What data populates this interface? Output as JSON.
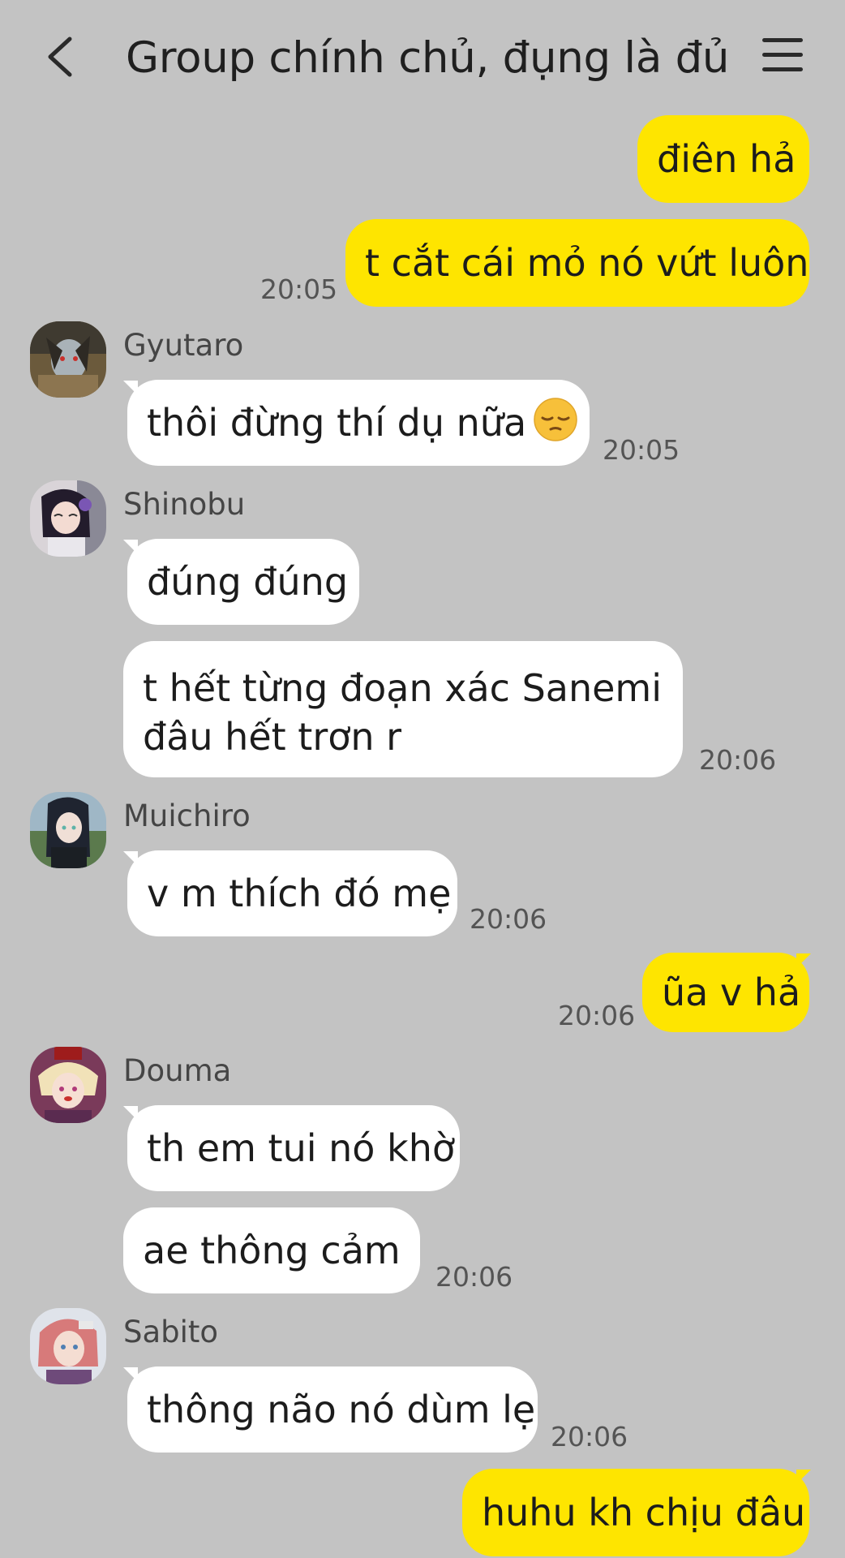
{
  "header": {
    "title": "Group chính chủ, đụng là đủ"
  },
  "messages": {
    "m1": {
      "text": "điên hả"
    },
    "m2": {
      "text": "t cắt cái mỏ nó vứt luôn",
      "time": "20:05"
    },
    "gyutaro": {
      "name": "Gyutaro",
      "text": "thôi đừng thí dụ nữa",
      "emoji": "pensive-face",
      "time": "20:05"
    },
    "shinobu": {
      "name": "Shinobu",
      "text1": "đúng đúng",
      "text2": "t hết từng đoạn xác Sanemi đâu hết trơn r",
      "time": "20:06"
    },
    "muichiro": {
      "name": "Muichiro",
      "text": "v m thích đó mẹ",
      "time": "20:06"
    },
    "m_out2": {
      "text": "ũa v hả",
      "time": "20:06"
    },
    "douma": {
      "name": "Douma",
      "text1": "th em tui nó khờ",
      "text2": "ae thông cảm",
      "time": "20:06"
    },
    "sabito": {
      "name": "Sabito",
      "text": "thông não nó dùm lẹ",
      "time": "20:06"
    },
    "m_out3": {
      "text": "huhu kh chịu đâu"
    }
  },
  "colors": {
    "background": "#c3c3c3",
    "outgoing_bubble": "#fee500",
    "incoming_bubble": "#ffffff"
  }
}
